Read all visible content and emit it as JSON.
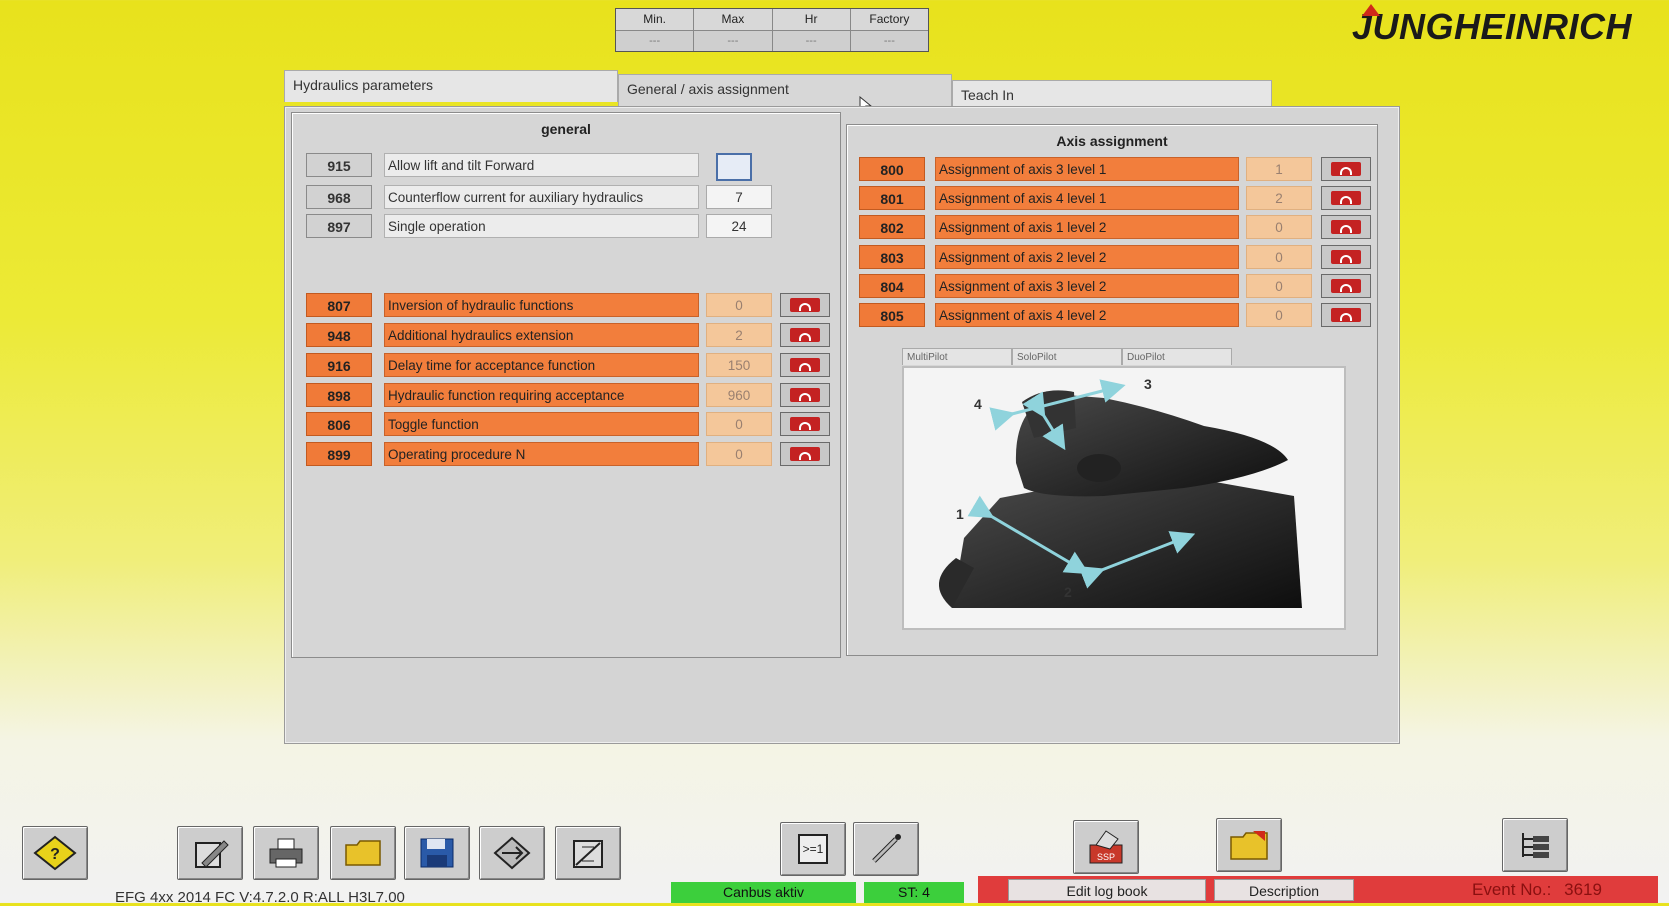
{
  "minmax": {
    "headers": [
      "Min.",
      "Max",
      "Hr",
      "Factory"
    ],
    "values": [
      "---",
      "---",
      "---",
      "---"
    ]
  },
  "logo": "JUNGHEINRICH",
  "tabs": [
    {
      "label": "Hydraulics parameters"
    },
    {
      "label": "General / axis assignment"
    },
    {
      "label": "Teach In"
    }
  ],
  "general": {
    "title": "general",
    "rows": [
      {
        "num": "915",
        "label": "Allow lift and tilt Forward",
        "value": ""
      },
      {
        "num": "968",
        "label": "Counterflow current for auxiliary hydraulics",
        "value": "7"
      },
      {
        "num": "897",
        "label": "Single operation",
        "value": "24"
      }
    ],
    "locked_rows": [
      {
        "num": "807",
        "label": "Inversion of hydraulic functions",
        "value": "0"
      },
      {
        "num": "948",
        "label": "Additional hydraulics extension",
        "value": "2"
      },
      {
        "num": "916",
        "label": "Delay time for acceptance function",
        "value": "150"
      },
      {
        "num": "898",
        "label": "Hydraulic function requiring acceptance",
        "value": "960"
      },
      {
        "num": "806",
        "label": "Toggle function",
        "value": "0"
      },
      {
        "num": "899",
        "label": "Operating procedure N",
        "value": "0"
      }
    ]
  },
  "axis": {
    "title": "Axis assignment",
    "rows": [
      {
        "num": "800",
        "label": "Assignment of axis 3 level 1",
        "value": "1"
      },
      {
        "num": "801",
        "label": "Assignment of axis 4 level 1",
        "value": "2"
      },
      {
        "num": "802",
        "label": "Assignment of axis 1 level 2",
        "value": "0"
      },
      {
        "num": "803",
        "label": "Assignment of axis 2 level 2",
        "value": "0"
      },
      {
        "num": "804",
        "label": "Assignment of axis 3 level 2",
        "value": "0"
      },
      {
        "num": "805",
        "label": "Assignment of axis 4 level 2",
        "value": "0"
      }
    ],
    "pilot_tabs": [
      "MultiPilot",
      "SoloPilot",
      "DuoPilot"
    ],
    "axis_labels": [
      "1",
      "2",
      "3",
      "4"
    ]
  },
  "status": {
    "canbus": "Canbus aktiv",
    "st": "ST: 4",
    "version": "EFG 4xx 2014 FC V:4.7.2.0 R:ALL H3L7.00",
    "edit_log": "Edit log book",
    "description": "Description",
    "event_label": "Event No.:",
    "event_no": "3619"
  },
  "colors": {
    "orange": "#f07a38",
    "lock_red": "#c42222",
    "canbus_green": "#3ccf3c",
    "status_red": "#e03c3c",
    "background_yellow": "#e8e21c"
  }
}
